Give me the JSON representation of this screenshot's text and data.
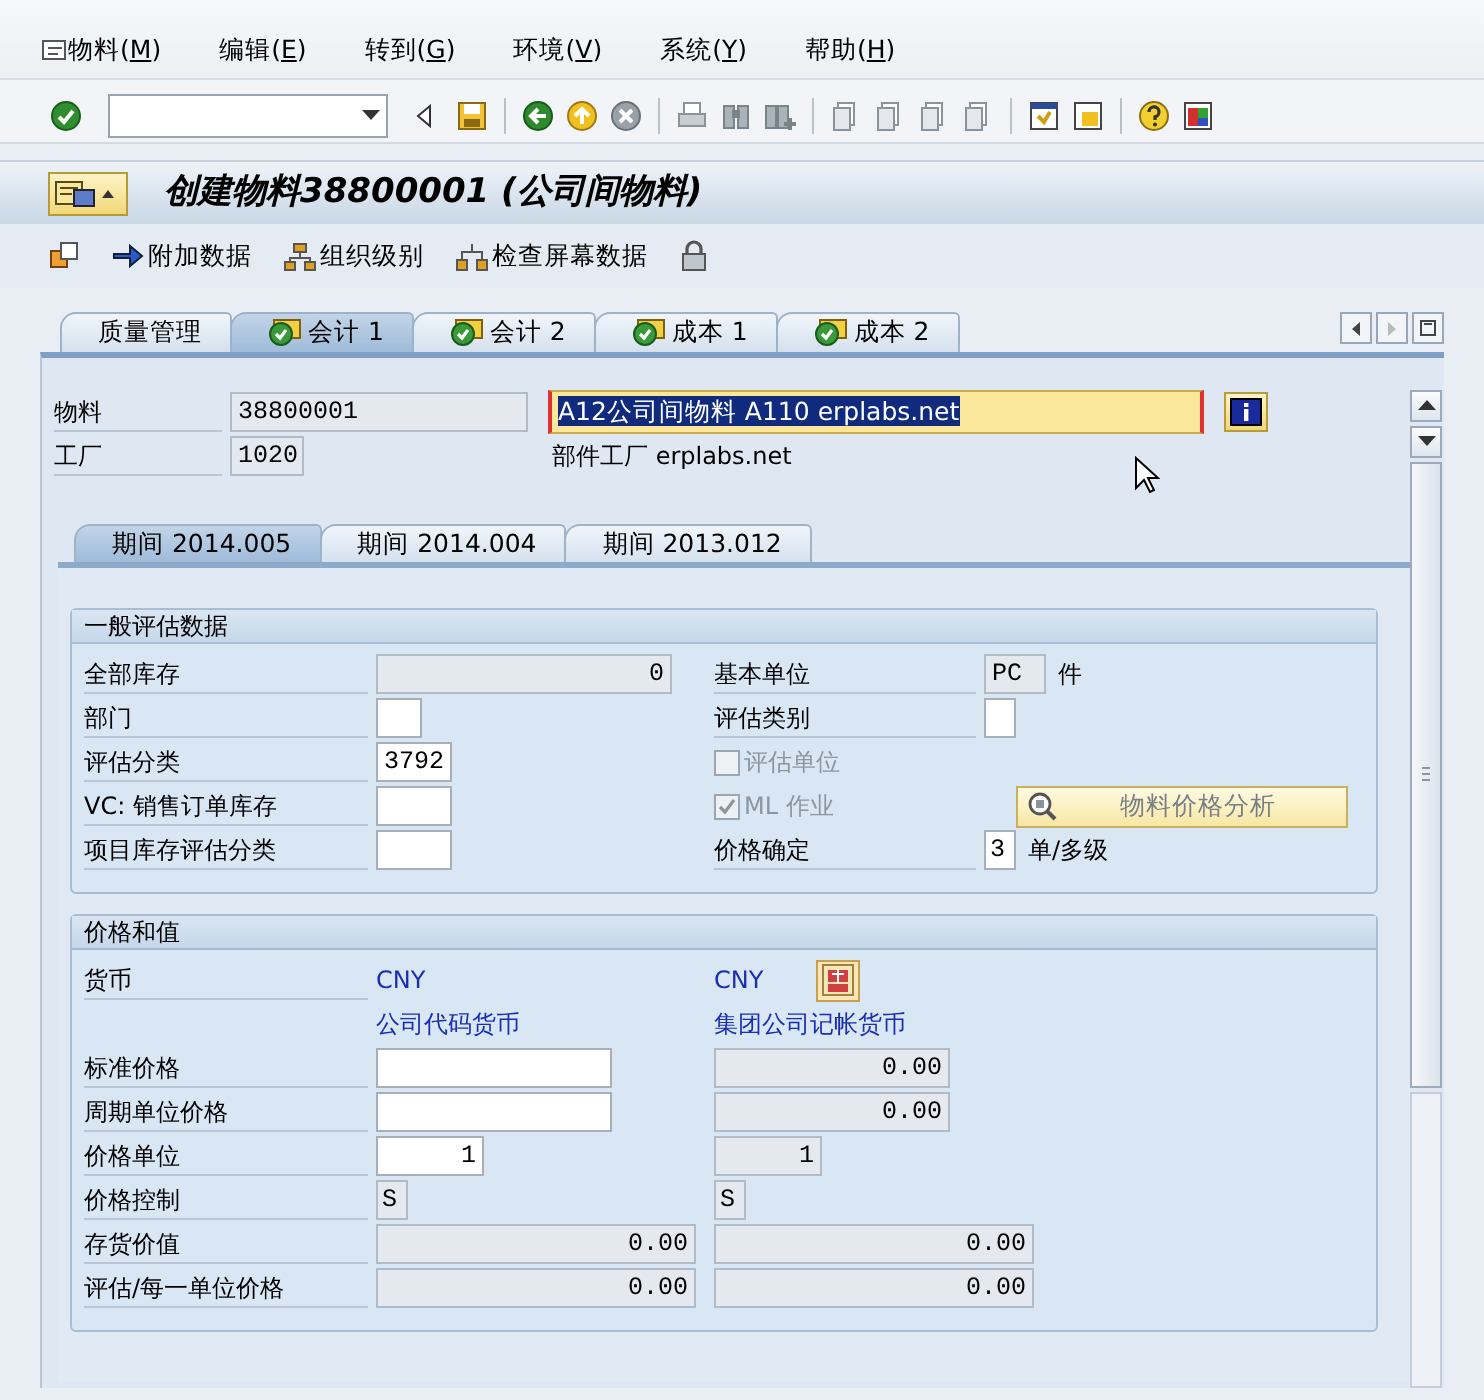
{
  "menu": [
    {
      "before": "物料(",
      "key": "M",
      "after": ")"
    },
    {
      "before": "编辑(",
      "key": "E",
      "after": ")"
    },
    {
      "before": "转到(",
      "key": "G",
      "after": ")"
    },
    {
      "before": "环境(",
      "key": "V",
      "after": ")"
    },
    {
      "before": "系统(",
      "key": "Y",
      "after": ")"
    },
    {
      "before": "帮助(",
      "key": "H",
      "after": ")"
    }
  ],
  "title": "创建物料38800001 (公司间物料)",
  "app_toolbar": [
    {
      "label": "附加数据",
      "kind": "arrow"
    },
    {
      "label": "组织级别",
      "kind": "org"
    },
    {
      "label": "检查屏幕数据",
      "kind": "check"
    }
  ],
  "tabs": [
    {
      "label": "质量管理",
      "selected": false,
      "checked": false
    },
    {
      "label": "会计 1",
      "selected": true,
      "checked": true
    },
    {
      "label": "会计 2",
      "selected": false,
      "checked": true
    },
    {
      "label": "成本 1",
      "selected": false,
      "checked": true
    },
    {
      "label": "成本 2",
      "selected": false,
      "checked": true
    }
  ],
  "header": {
    "material_label": "物料",
    "material": "38800001",
    "description": "A12公司间物料 A110 erplabs.net",
    "description_selected": true,
    "plant_label": "工厂",
    "plant": "1020",
    "plant_text": "部件工厂 erplabs.net"
  },
  "period_tabs": [
    {
      "label": "期间 2014.005",
      "selected": true
    },
    {
      "label": "期间 2014.004",
      "selected": false
    },
    {
      "label": "期间 2013.012",
      "selected": false
    }
  ],
  "groups": [
    {
      "title": "一般评估数据",
      "rows": [
        {
          "cells": [
            {
              "kind": "label",
              "text": "全部库存"
            },
            {
              "kind": "field",
              "value": "0",
              "readonly": true
            },
            {
              "kind": "label",
              "text": "基本单位"
            },
            {
              "kind": "field",
              "value": "PC",
              "readonly": true,
              "unit": "件"
            }
          ]
        },
        {
          "cells": [
            {
              "kind": "label",
              "text": "部门"
            },
            {
              "kind": "field",
              "readonly": false
            },
            {
              "kind": "label",
              "text": "评估类别"
            },
            {
              "kind": "field",
              "readonly": false
            }
          ]
        },
        {
          "cells": [
            {
              "kind": "label",
              "text": "评估分类"
            },
            {
              "kind": "field",
              "value": "3792",
              "readonly": false
            },
            {
              "kind": "checkbox",
              "text": "评估单位",
              "checked": false,
              "disabled": true
            },
            {
              "kind": "empty"
            }
          ]
        },
        {
          "cells": [
            {
              "kind": "label",
              "text": "VC: 销售订单库存"
            },
            {
              "kind": "field",
              "readonly": false
            },
            {
              "kind": "checkbox",
              "text": "ML 作业",
              "checked": true,
              "disabled": true
            },
            {
              "kind": "button",
              "text": "物料价格分析"
            }
          ]
        },
        {
          "cells": [
            {
              "kind": "label",
              "text": "项目库存评估分类"
            },
            {
              "kind": "field",
              "readonly": false
            },
            {
              "kind": "label",
              "text": "价格确定"
            },
            {
              "kind": "field",
              "value": "3",
              "readonly": false,
              "unit": "单/多级"
            }
          ]
        }
      ]
    },
    {
      "title": "价格和值",
      "rows": [
        {
          "cells": [
            {
              "kind": "label",
              "text": "货币"
            },
            {
              "kind": "text",
              "text": "CNY",
              "has_button": false
            },
            {
              "kind": "text",
              "text": "CNY",
              "has_button": true
            }
          ]
        },
        {
          "cells": [
            {
              "kind": "empty"
            },
            {
              "kind": "text",
              "text": "公司代码货币",
              "has_button": false
            },
            {
              "kind": "text",
              "text": "集团公司记帐货币",
              "has_button": false
            }
          ]
        },
        {
          "cells": [
            {
              "kind": "label",
              "text": "标准价格"
            },
            {
              "kind": "field",
              "readonly": false
            },
            {
              "kind": "field",
              "value": "0.00",
              "readonly": true
            }
          ]
        },
        {
          "cells": [
            {
              "kind": "label",
              "text": "周期单位价格"
            },
            {
              "kind": "field",
              "readonly": false
            },
            {
              "kind": "field",
              "value": "0.00",
              "readonly": true
            }
          ]
        },
        {
          "cells": [
            {
              "kind": "label",
              "text": "价格单位"
            },
            {
              "kind": "field",
              "value": "1",
              "readonly": false
            },
            {
              "kind": "field",
              "value": "1",
              "readonly": true
            }
          ]
        },
        {
          "cells": [
            {
              "kind": "label",
              "text": "价格控制"
            },
            {
              "kind": "field",
              "value": "S",
              "readonly": true
            },
            {
              "kind": "field",
              "value": "S",
              "readonly": true
            }
          ]
        },
        {
          "cells": [
            {
              "kind": "label",
              "text": "存货价值"
            },
            {
              "kind": "field",
              "value": "0.00",
              "readonly": true
            },
            {
              "kind": "field",
              "value": "0.00",
              "readonly": true
            }
          ]
        },
        {
          "cells": [
            {
              "kind": "label",
              "text": "评估/每一单位价格"
            },
            {
              "kind": "field",
              "value": "0.00",
              "readonly": true
            },
            {
              "kind": "field",
              "value": "0.00",
              "readonly": true
            }
          ]
        }
      ]
    }
  ]
}
